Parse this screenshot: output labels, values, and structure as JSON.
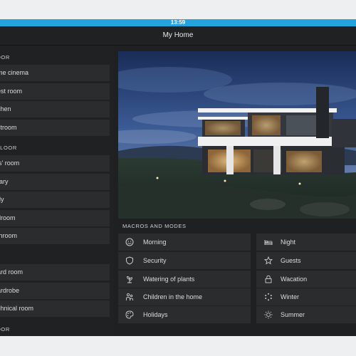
{
  "status_bar": {
    "time": "13:59"
  },
  "header": {
    "title": "My Home"
  },
  "sidebar": {
    "sections": [
      {
        "title": "OOR",
        "rooms": [
          "me cinema",
          "est room",
          "chen",
          "stroom"
        ]
      },
      {
        "title": "FLOOR",
        "rooms": [
          "ls' room",
          "rary",
          "dy",
          "droom",
          "throom"
        ]
      },
      {
        "title": "",
        "rooms": [
          "ard room",
          "ardrobe",
          "chnical room"
        ]
      },
      {
        "title": "OOR",
        "rooms": []
      }
    ]
  },
  "hero": {
    "alt": "house-photo"
  },
  "macros": {
    "title": "MACROS AND MODES",
    "left": [
      {
        "label": "Morning",
        "icon": "smiley-icon"
      },
      {
        "label": "Security",
        "icon": "shield-icon"
      },
      {
        "label": "Watering of plants",
        "icon": "plant-icon"
      },
      {
        "label": "Children in the home",
        "icon": "children-icon"
      },
      {
        "label": "Holidays",
        "icon": "palette-icon"
      }
    ],
    "right": [
      {
        "label": "Night",
        "icon": "bed-icon"
      },
      {
        "label": "Guests",
        "icon": "star-icon"
      },
      {
        "label": "Wacation",
        "icon": "lock-icon"
      },
      {
        "label": "Winter",
        "icon": "snowflake-icon"
      },
      {
        "label": "Summer",
        "icon": "sun-icon"
      }
    ]
  }
}
